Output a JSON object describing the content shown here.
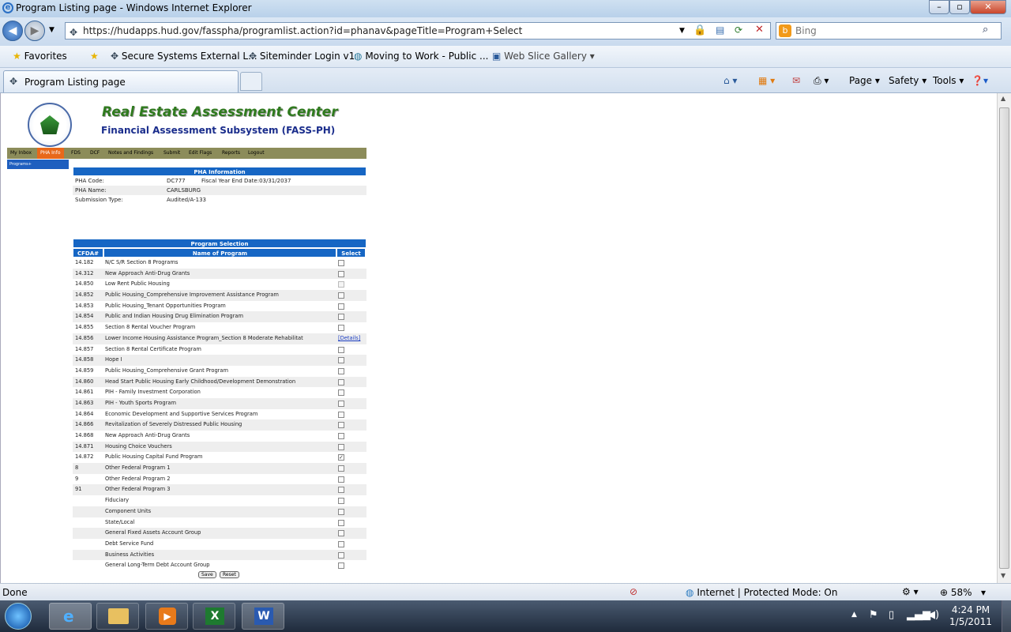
{
  "window": {
    "title": "Program Listing page - Windows Internet Explorer"
  },
  "browser": {
    "url": "https://hudapps.hud.gov/fasspha/programlist.action?id=phanav&pageTitle=Program+Select",
    "search_placeholder": "Bing",
    "favorites_label": "Favorites",
    "favorites": [
      "Secure Systems External L...",
      "Siteminder Login v1",
      "Moving to Work - Public ...",
      "Web Slice Gallery"
    ],
    "tab_label": "Program Listing page",
    "commands": [
      "Page",
      "Safety",
      "Tools"
    ]
  },
  "page": {
    "org_title": "Real Estate Assessment Center",
    "subsystem_title": "Financial Assessment Subsystem (FASS-PH)",
    "menu": [
      "My Inbox",
      "PHA Info",
      "FDS",
      "DCF",
      "Notes and Findings",
      "Submit",
      "Edit Flags",
      "Reports",
      "Logout"
    ],
    "active_menu": "PHA Info",
    "submenu": "Programs+",
    "pha_info": {
      "header": "PHA Information",
      "rows": [
        {
          "label": "PHA Code:",
          "value": "DC777",
          "extra": "Fiscal Year End Date:03/31/2037"
        },
        {
          "label": "PHA Name:",
          "value": "CARLSBURG",
          "extra": ""
        },
        {
          "label": "Submission Type:",
          "value": "Audited/A-133",
          "extra": ""
        }
      ]
    },
    "program_selection": {
      "header": "Program Selection",
      "columns": [
        "CFDA#",
        "Name of Program",
        "Select"
      ],
      "rows": [
        {
          "cfda": "14.182",
          "name": "N/C S/R Section 8 Programs",
          "state": "unchecked"
        },
        {
          "cfda": "14.312",
          "name": "New Approach Anti-Drug Grants",
          "state": "unchecked"
        },
        {
          "cfda": "14.850",
          "name": "Low Rent Public Housing",
          "state": "disabled"
        },
        {
          "cfda": "14.852",
          "name": "Public Housing_Comprehensive Improvement Assistance Program",
          "state": "unchecked"
        },
        {
          "cfda": "14.853",
          "name": "Public Housing_Tenant Opportunities Program",
          "state": "unchecked"
        },
        {
          "cfda": "14.854",
          "name": "Public and Indian Housing Drug Elimination Program",
          "state": "unchecked"
        },
        {
          "cfda": "14.855",
          "name": "Section 8 Rental Voucher Program",
          "state": "unchecked"
        },
        {
          "cfda": "14.856",
          "name": "Lower Income Housing Assistance Program_Section 8 Moderate Rehabilitat",
          "state": "details"
        },
        {
          "cfda": "14.857",
          "name": "Section 8 Rental Certificate Program",
          "state": "unchecked"
        },
        {
          "cfda": "14.858",
          "name": "Hope I",
          "state": "unchecked"
        },
        {
          "cfda": "14.859",
          "name": "Public Housing_Comprehensive Grant Program",
          "state": "unchecked"
        },
        {
          "cfda": "14.860",
          "name": "Head Start Public Housing Early Childhood/Development Demonstration",
          "state": "unchecked"
        },
        {
          "cfda": "14.861",
          "name": "PIH - Family Investment Corporation",
          "state": "unchecked"
        },
        {
          "cfda": "14.863",
          "name": "PIH - Youth Sports Program",
          "state": "unchecked"
        },
        {
          "cfda": "14.864",
          "name": "Economic Development and Supportive Services Program",
          "state": "unchecked"
        },
        {
          "cfda": "14.866",
          "name": "Revitalization of Severely Distressed Public Housing",
          "state": "unchecked"
        },
        {
          "cfda": "14.868",
          "name": "New Approach Anti-Drug Grants",
          "state": "unchecked"
        },
        {
          "cfda": "14.871",
          "name": "Housing Choice Vouchers",
          "state": "unchecked"
        },
        {
          "cfda": "14.872",
          "name": "Public Housing Capital Fund Program",
          "state": "checked"
        },
        {
          "cfda": "8",
          "name": "Other Federal Program 1",
          "state": "unchecked"
        },
        {
          "cfda": "9",
          "name": "Other Federal Program 2",
          "state": "unchecked"
        },
        {
          "cfda": "91",
          "name": "Other Federal Program 3",
          "state": "unchecked"
        },
        {
          "cfda": "",
          "name": "Fiduciary",
          "state": "unchecked"
        },
        {
          "cfda": "",
          "name": "Component Units",
          "state": "unchecked"
        },
        {
          "cfda": "",
          "name": "State/Local",
          "state": "unchecked"
        },
        {
          "cfda": "",
          "name": "General Fixed Assets Account Group",
          "state": "unchecked"
        },
        {
          "cfda": "",
          "name": "Debt Service Fund",
          "state": "unchecked"
        },
        {
          "cfda": "",
          "name": "Business Activities",
          "state": "unchecked"
        },
        {
          "cfda": "",
          "name": "General Long-Term Debt Account Group",
          "state": "unchecked"
        }
      ],
      "details_label": "[Details]",
      "save_label": "Save",
      "reset_label": "Reset"
    }
  },
  "status": {
    "left": "Done",
    "zone": "Internet | Protected Mode: On",
    "zoom": "58%"
  },
  "taskbar": {
    "time": "4:24 PM",
    "date": "1/5/2011"
  }
}
